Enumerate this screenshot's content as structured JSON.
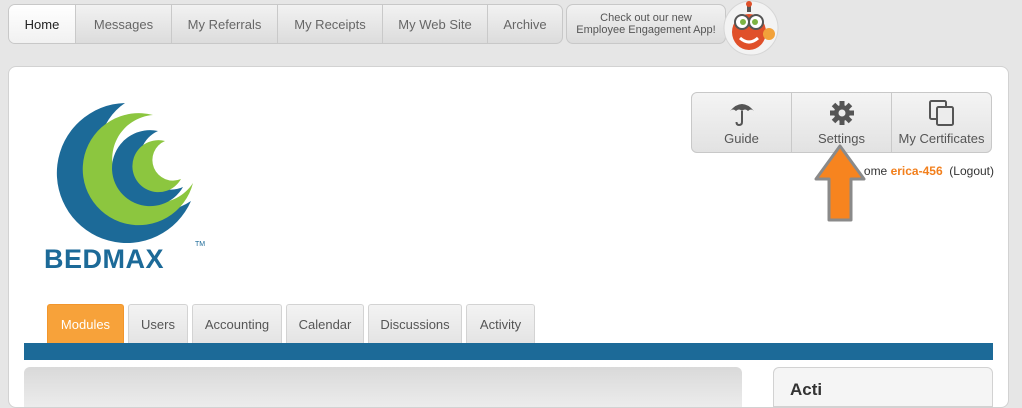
{
  "topnav": {
    "items": [
      {
        "label": "Home",
        "active": true
      },
      {
        "label": "Messages",
        "active": false
      },
      {
        "label": "My Referrals",
        "active": false
      },
      {
        "label": "My Receipts",
        "active": false
      },
      {
        "label": "My Web Site",
        "active": false
      },
      {
        "label": "Archive",
        "active": false
      }
    ]
  },
  "promo": {
    "line1": "Check out our new",
    "line2": "Employee Engagement App!"
  },
  "logo": {
    "text": "BEDMAX",
    "tm": "TM"
  },
  "toolbar": {
    "guide_label": "Guide",
    "settings_label": "Settings",
    "certificates_label": "My Certificates"
  },
  "welcome": {
    "prefix": "ome",
    "username": "erica-456",
    "logout": "(Logout)"
  },
  "tabs": [
    {
      "label": "Modules",
      "active": true
    },
    {
      "label": "Users",
      "active": false
    },
    {
      "label": "Accounting",
      "active": false
    },
    {
      "label": "Calendar",
      "active": false
    },
    {
      "label": "Discussions",
      "active": false
    },
    {
      "label": "Activity",
      "active": false
    }
  ],
  "side": {
    "title": "Acti"
  },
  "colors": {
    "accent": "#f7a23a",
    "brand_blue": "#1c6a98",
    "brand_green": "#8cc63f",
    "username": "#f27f1c"
  }
}
